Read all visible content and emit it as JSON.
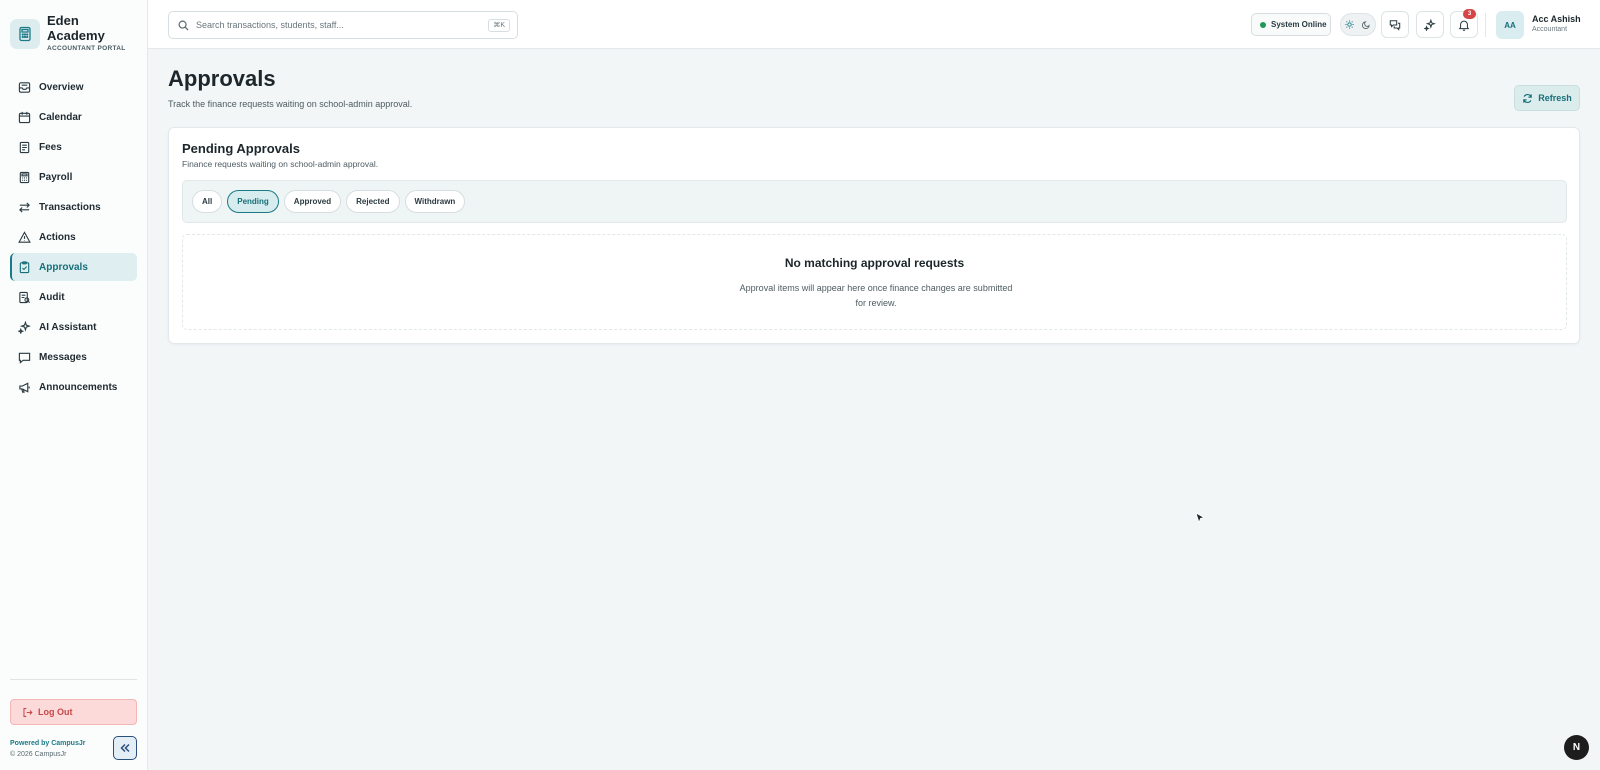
{
  "brand": {
    "name": "Eden Academy",
    "subtitle": "ACCOUNTANT PORTAL",
    "icon": "calculator-icon"
  },
  "sidebar": {
    "items": [
      {
        "label": "Overview",
        "icon": "inbox-icon",
        "active": false
      },
      {
        "label": "Calendar",
        "icon": "calendar-icon",
        "active": false
      },
      {
        "label": "Fees",
        "icon": "receipt-icon",
        "active": false
      },
      {
        "label": "Payroll",
        "icon": "calculator-icon",
        "active": false
      },
      {
        "label": "Transactions",
        "icon": "arrows-exchange-icon",
        "active": false
      },
      {
        "label": "Actions",
        "icon": "warning-triangle-icon",
        "active": false
      },
      {
        "label": "Approvals",
        "icon": "clipboard-check-icon",
        "active": true
      },
      {
        "label": "Audit",
        "icon": "audit-log-icon",
        "active": false
      },
      {
        "label": "AI Assistant",
        "icon": "sparkles-icon",
        "active": false
      },
      {
        "label": "Messages",
        "icon": "chat-bubble-icon",
        "active": false
      },
      {
        "label": "Announcements",
        "icon": "megaphone-icon",
        "active": false
      }
    ],
    "logout_label": "Log Out",
    "powered_by": "Powered by CampusJr",
    "copyright": "© 2026 CampusJr"
  },
  "topbar": {
    "search_placeholder": "Search transactions, students, staff...",
    "search_shortcut": "⌘K",
    "system_status": "System Online",
    "notification_count": "3",
    "user": {
      "initials": "AA",
      "name": "Acc Ashish",
      "role": "Accountant"
    }
  },
  "main": {
    "title": "Approvals",
    "subtitle": "Track the finance requests waiting on school-admin approval.",
    "refresh_label": "Refresh",
    "panel": {
      "title": "Pending Approvals",
      "subtitle": "Finance requests waiting on school-admin approval.",
      "filters": [
        {
          "label": "All",
          "active": false
        },
        {
          "label": "Pending",
          "active": true
        },
        {
          "label": "Approved",
          "active": false
        },
        {
          "label": "Rejected",
          "active": false
        },
        {
          "label": "Withdrawn",
          "active": false
        }
      ],
      "empty_title": "No matching approval requests",
      "empty_description": "Approval items will appear here once finance changes are submitted for review."
    }
  },
  "floating_badge": "N",
  "colors": {
    "accent": "#1a7b86",
    "active_bg": "#dfeef0",
    "logout_bg": "#fcdada",
    "logout_text": "#c64848",
    "status_green": "#1f9a56",
    "badge_red": "#d64545"
  }
}
